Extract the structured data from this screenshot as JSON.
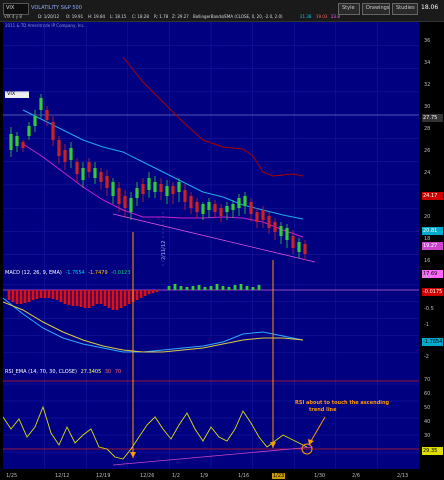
{
  "toolbar": {
    "symbol": "VIX",
    "description": "VOLATILITY S&P 500",
    "bar_date": "D: 1/20/12",
    "open": "O: 19.91",
    "high": "H: 19.84",
    "low": "L: 18.15",
    "close": "C: 18.28",
    "range": "R: 1.78",
    "change": "Z: 29.27",
    "study_label": "BollingerBands/EMA (CLOSE, 0, 20, -2.0, 2.0)",
    "bb_value_1": "21.38",
    "bb_value_2": "19.03",
    "bb_value_3": "23.8",
    "buttons": [
      "Style",
      "Drawings",
      "Studies"
    ],
    "price": "18.06",
    "timeframe": "VIX 4 y 8"
  },
  "copyright": "2011 & TD Ameritrade IP Company, Inc.",
  "price_panel": {
    "symbol_box": "VIX",
    "y_labels": [
      "36",
      "34",
      "32",
      "30",
      "28",
      "26",
      "24",
      "22",
      "20",
      "18",
      "16"
    ],
    "tags": [
      {
        "value": "27.75",
        "color": "#333333",
        "text_color": "#ffffff"
      },
      {
        "value": "24.17",
        "color": "#cc0000",
        "text_color": "#ffffff"
      },
      {
        "value": "20.81",
        "color": "#00aacc",
        "text_color": "#ffffff"
      },
      {
        "value": "19.27",
        "color": "#cc44cc",
        "text_color": "#ffffff"
      },
      {
        "value": "17.69",
        "color": "#ff66ff",
        "text_color": "#000000"
      }
    ],
    "marker_text": "2/11/12"
  },
  "macd_panel": {
    "title": "MACD (12, 26, 9, EMA)",
    "value_1": "-1.7654",
    "value_2": "-1.7479",
    "value_3": "-0.0123",
    "y_labels": [
      "0.5",
      "0",
      "-0.5",
      "-1",
      "-1.5",
      "-2"
    ],
    "tags": [
      {
        "value": "-0.0175",
        "color": "#cc0000",
        "text_color": "#ffffff"
      },
      {
        "value": "-1.7654",
        "color": "#00aacc",
        "text_color": "#000000"
      }
    ]
  },
  "rsi_panel": {
    "title": "RSI_EMA (14, 70, 30, CLOSE)",
    "value": "27.3405",
    "ob": "30",
    "os": "70",
    "y_labels": [
      "70",
      "60",
      "50",
      "40",
      "30",
      "20"
    ],
    "tags": [
      {
        "value": "29.35",
        "color": "#dddd00",
        "text_color": "#000000"
      }
    ],
    "annotation_line1": "RSI about to touch the ascending",
    "annotation_line2": "trend line"
  },
  "x_axis": {
    "labels": [
      "1/25",
      "12/12",
      "12/19",
      "12/26",
      "1/2",
      "1/9",
      "1/16",
      "1/23",
      "1/30",
      "2/6",
      "2/13"
    ],
    "highlight": "1/23"
  },
  "colors": {
    "panel_bg": "#000080",
    "upper_band": "#aa0000",
    "mid_band": "#22aaee",
    "lower_band": "#cc22cc",
    "rsi_line": "#dddd00",
    "arrow": "#ff9900",
    "annotation": "#ff9900"
  }
}
